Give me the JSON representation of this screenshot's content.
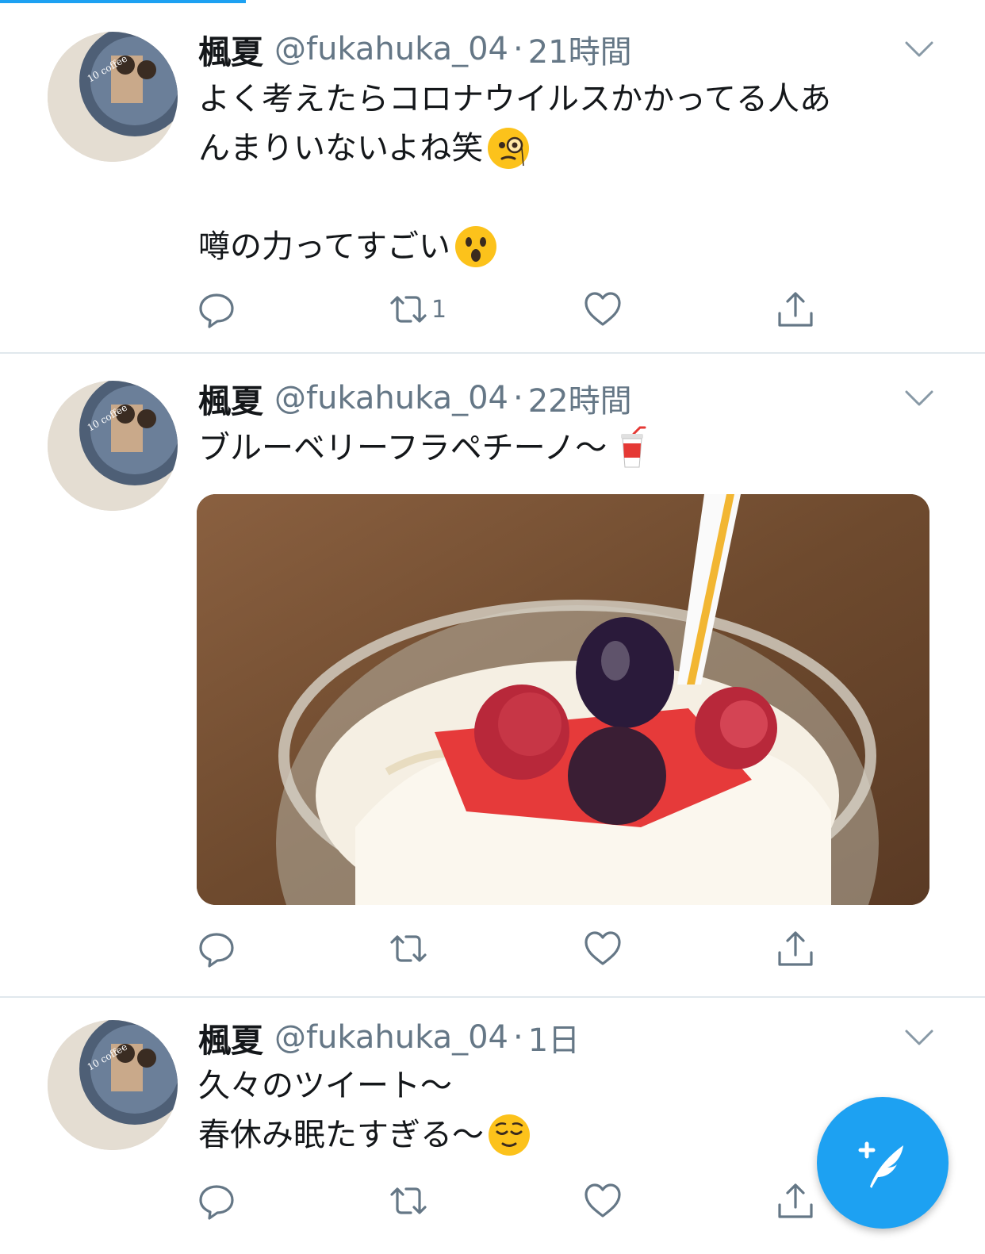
{
  "timeline": {
    "tweets": [
      {
        "name": "楓夏",
        "handle": "@fukahuka_04",
        "separator": "·",
        "time": "21時間",
        "lines": [
          "よく考えたらコロナウイルスかかってる人あ",
          "んまりいないよね笑",
          "",
          "噂の力ってすごい"
        ],
        "emojis": [
          "face-with-monocle",
          "hushed-face"
        ],
        "has_media": false,
        "retweet_count": "1"
      },
      {
        "name": "楓夏",
        "handle": "@fukahuka_04",
        "separator": "·",
        "time": "22時間",
        "lines": [
          "ブルーベリーフラペチーノ〜"
        ],
        "emojis": [
          "cup-with-straw"
        ],
        "has_media": true,
        "media_description": "frappuccino with berries in a glass jar with a straw",
        "retweet_count": ""
      },
      {
        "name": "楓夏",
        "handle": "@fukahuka_04",
        "separator": "·",
        "time": "1日",
        "lines": [
          "久々のツイート〜",
          "春休み眠たすぎる〜"
        ],
        "emojis": [
          "relieved-face"
        ],
        "has_media": false,
        "retweet_count": ""
      }
    ]
  },
  "icons": {
    "reply": "reply-icon",
    "retweet": "retweet-icon",
    "like": "heart-icon",
    "share": "share-icon",
    "menu": "chevron-down-icon",
    "compose": "compose-tweet-icon"
  },
  "colors": {
    "accent": "#1da1f2",
    "secondary_text": "#657786",
    "divider": "#e1e8ed"
  }
}
